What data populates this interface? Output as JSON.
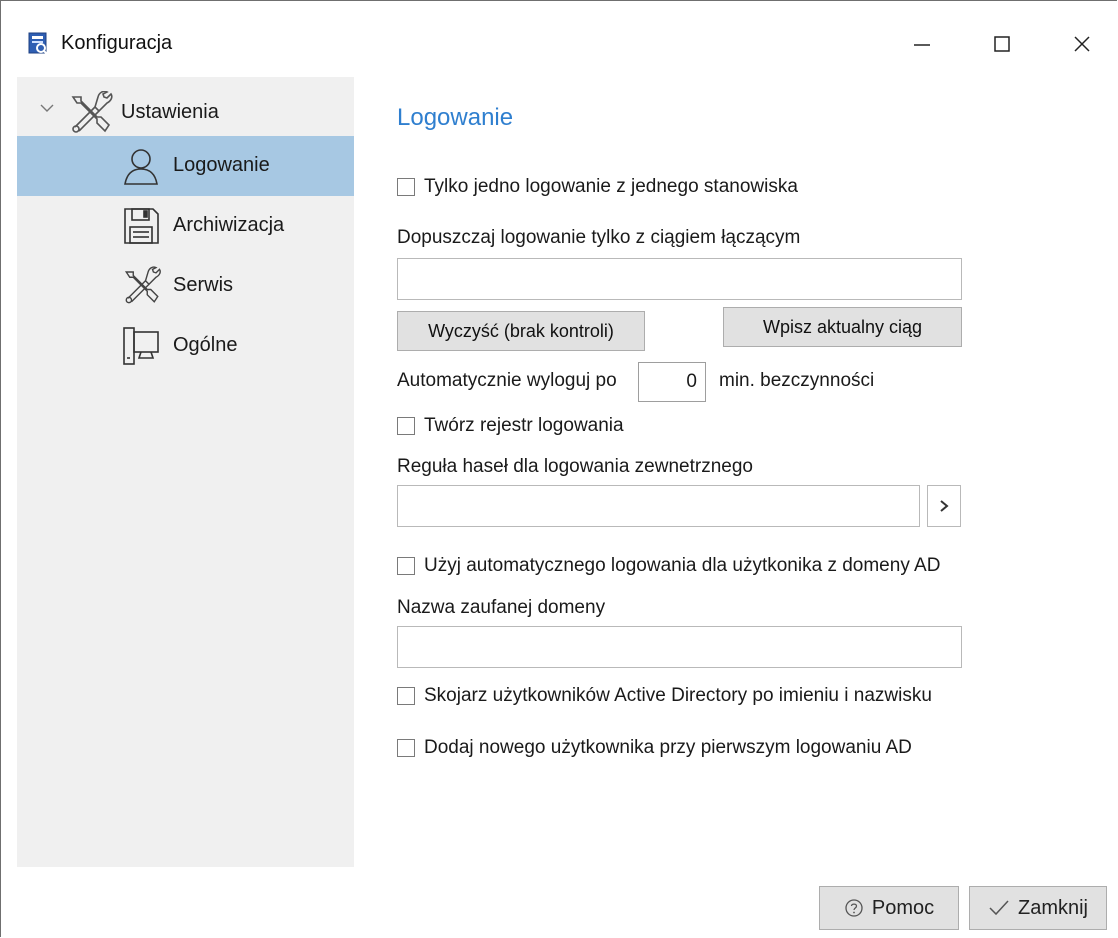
{
  "window": {
    "title": "Konfiguracja"
  },
  "sidebar": {
    "root_label": "Ustawienia",
    "items": [
      {
        "label": "Logowanie",
        "icon": "user-icon",
        "selected": true
      },
      {
        "label": "Archiwizacja",
        "icon": "floppy-disk-icon",
        "selected": false
      },
      {
        "label": "Serwis",
        "icon": "tools-icon",
        "selected": false
      },
      {
        "label": "Ogólne",
        "icon": "computer-icon",
        "selected": false
      }
    ]
  },
  "content": {
    "title": "Logowanie",
    "single_login_label": "Tylko jedno logowanie z jednego stanowiska",
    "connection_string_label": "Dopuszczaj logowanie tylko z ciągiem łączącym",
    "connection_string_value": "",
    "clear_button": "Wyczyść (brak kontroli)",
    "enter_current_button": "Wpisz aktualny ciąg",
    "auto_logout_prefix": "Automatycznie wyloguj po",
    "auto_logout_value": "0",
    "auto_logout_suffix": "min. bezczynności",
    "login_register_label": "Twórz rejestr logowania",
    "password_rule_label": "Reguła haseł dla logowania zewnetrznego",
    "password_rule_value": "",
    "auto_login_ad_label": "Użyj automatycznego logowania dla użytkonika z domeny AD",
    "trusted_domain_label": "Nazwa zaufanej domeny",
    "trusted_domain_value": "",
    "match_ad_users_label": "Skojarz użytkowników Active Directory po imieniu i nazwisku",
    "add_new_user_label": "Dodaj  nowego użytkownika przy pierwszym logowaniu AD"
  },
  "footer": {
    "help_button": "Pomoc",
    "close_button": "Zamknij"
  },
  "colors": {
    "accent_title": "#2f7fcf",
    "selection": "#a7c8e3",
    "sidebar_bg": "#f0f0f0"
  }
}
